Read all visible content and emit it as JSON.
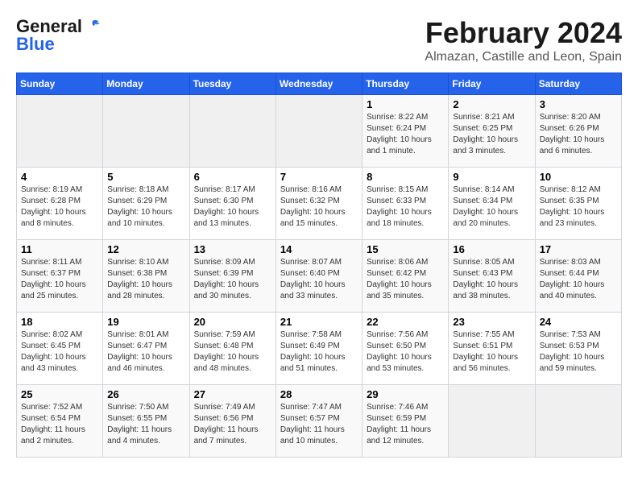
{
  "header": {
    "logo_general": "General",
    "logo_blue": "Blue",
    "main_title": "February 2024",
    "subtitle": "Almazan, Castille and Leon, Spain"
  },
  "calendar": {
    "weekdays": [
      "Sunday",
      "Monday",
      "Tuesday",
      "Wednesday",
      "Thursday",
      "Friday",
      "Saturday"
    ],
    "weeks": [
      [
        {
          "day": "",
          "info": ""
        },
        {
          "day": "",
          "info": ""
        },
        {
          "day": "",
          "info": ""
        },
        {
          "day": "",
          "info": ""
        },
        {
          "day": "1",
          "info": "Sunrise: 8:22 AM\nSunset: 6:24 PM\nDaylight: 10 hours and 1 minute."
        },
        {
          "day": "2",
          "info": "Sunrise: 8:21 AM\nSunset: 6:25 PM\nDaylight: 10 hours and 3 minutes."
        },
        {
          "day": "3",
          "info": "Sunrise: 8:20 AM\nSunset: 6:26 PM\nDaylight: 10 hours and 6 minutes."
        }
      ],
      [
        {
          "day": "4",
          "info": "Sunrise: 8:19 AM\nSunset: 6:28 PM\nDaylight: 10 hours and 8 minutes."
        },
        {
          "day": "5",
          "info": "Sunrise: 8:18 AM\nSunset: 6:29 PM\nDaylight: 10 hours and 10 minutes."
        },
        {
          "day": "6",
          "info": "Sunrise: 8:17 AM\nSunset: 6:30 PM\nDaylight: 10 hours and 13 minutes."
        },
        {
          "day": "7",
          "info": "Sunrise: 8:16 AM\nSunset: 6:32 PM\nDaylight: 10 hours and 15 minutes."
        },
        {
          "day": "8",
          "info": "Sunrise: 8:15 AM\nSunset: 6:33 PM\nDaylight: 10 hours and 18 minutes."
        },
        {
          "day": "9",
          "info": "Sunrise: 8:14 AM\nSunset: 6:34 PM\nDaylight: 10 hours and 20 minutes."
        },
        {
          "day": "10",
          "info": "Sunrise: 8:12 AM\nSunset: 6:35 PM\nDaylight: 10 hours and 23 minutes."
        }
      ],
      [
        {
          "day": "11",
          "info": "Sunrise: 8:11 AM\nSunset: 6:37 PM\nDaylight: 10 hours and 25 minutes."
        },
        {
          "day": "12",
          "info": "Sunrise: 8:10 AM\nSunset: 6:38 PM\nDaylight: 10 hours and 28 minutes."
        },
        {
          "day": "13",
          "info": "Sunrise: 8:09 AM\nSunset: 6:39 PM\nDaylight: 10 hours and 30 minutes."
        },
        {
          "day": "14",
          "info": "Sunrise: 8:07 AM\nSunset: 6:40 PM\nDaylight: 10 hours and 33 minutes."
        },
        {
          "day": "15",
          "info": "Sunrise: 8:06 AM\nSunset: 6:42 PM\nDaylight: 10 hours and 35 minutes."
        },
        {
          "day": "16",
          "info": "Sunrise: 8:05 AM\nSunset: 6:43 PM\nDaylight: 10 hours and 38 minutes."
        },
        {
          "day": "17",
          "info": "Sunrise: 8:03 AM\nSunset: 6:44 PM\nDaylight: 10 hours and 40 minutes."
        }
      ],
      [
        {
          "day": "18",
          "info": "Sunrise: 8:02 AM\nSunset: 6:45 PM\nDaylight: 10 hours and 43 minutes."
        },
        {
          "day": "19",
          "info": "Sunrise: 8:01 AM\nSunset: 6:47 PM\nDaylight: 10 hours and 46 minutes."
        },
        {
          "day": "20",
          "info": "Sunrise: 7:59 AM\nSunset: 6:48 PM\nDaylight: 10 hours and 48 minutes."
        },
        {
          "day": "21",
          "info": "Sunrise: 7:58 AM\nSunset: 6:49 PM\nDaylight: 10 hours and 51 minutes."
        },
        {
          "day": "22",
          "info": "Sunrise: 7:56 AM\nSunset: 6:50 PM\nDaylight: 10 hours and 53 minutes."
        },
        {
          "day": "23",
          "info": "Sunrise: 7:55 AM\nSunset: 6:51 PM\nDaylight: 10 hours and 56 minutes."
        },
        {
          "day": "24",
          "info": "Sunrise: 7:53 AM\nSunset: 6:53 PM\nDaylight: 10 hours and 59 minutes."
        }
      ],
      [
        {
          "day": "25",
          "info": "Sunrise: 7:52 AM\nSunset: 6:54 PM\nDaylight: 11 hours and 2 minutes."
        },
        {
          "day": "26",
          "info": "Sunrise: 7:50 AM\nSunset: 6:55 PM\nDaylight: 11 hours and 4 minutes."
        },
        {
          "day": "27",
          "info": "Sunrise: 7:49 AM\nSunset: 6:56 PM\nDaylight: 11 hours and 7 minutes."
        },
        {
          "day": "28",
          "info": "Sunrise: 7:47 AM\nSunset: 6:57 PM\nDaylight: 11 hours and 10 minutes."
        },
        {
          "day": "29",
          "info": "Sunrise: 7:46 AM\nSunset: 6:59 PM\nDaylight: 11 hours and 12 minutes."
        },
        {
          "day": "",
          "info": ""
        },
        {
          "day": "",
          "info": ""
        }
      ]
    ]
  }
}
